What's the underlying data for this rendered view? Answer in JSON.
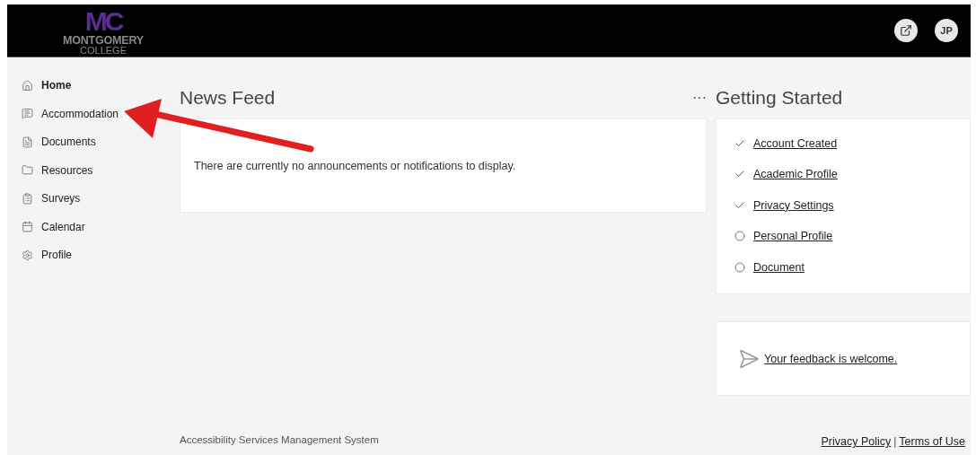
{
  "header": {
    "logo": {
      "mark": "MC",
      "line_1": "MONTGOMERY",
      "line_2": "COLLEGE"
    },
    "avatar": "JP"
  },
  "sidebar": {
    "items": [
      {
        "label": "Home",
        "selected": true
      },
      {
        "label": "Accommodation",
        "selected": false
      },
      {
        "label": "Documents",
        "selected": false
      },
      {
        "label": "Resources",
        "selected": false
      },
      {
        "label": "Surveys",
        "selected": false
      },
      {
        "label": "Calendar",
        "selected": false
      },
      {
        "label": "Profile",
        "selected": false
      }
    ]
  },
  "news_feed": {
    "title": "News Feed",
    "more": "···",
    "message": "There are currently no announcements or notifications to display."
  },
  "getting_started": {
    "title": "Getting Started",
    "steps": [
      {
        "label": "Account Created",
        "done": true
      },
      {
        "label": "Academic Profile",
        "done": true
      },
      {
        "label": "Privacy Settings",
        "done": true
      },
      {
        "label": "Personal Profile",
        "done": false
      },
      {
        "label": "Document",
        "done": false
      }
    ]
  },
  "feedback": {
    "link": "Your feedback is welcome."
  },
  "footer": {
    "system_name": "Accessibility Services Management System",
    "links": [
      "Privacy Policy",
      "Terms of Use"
    ],
    "separator": "|"
  }
}
